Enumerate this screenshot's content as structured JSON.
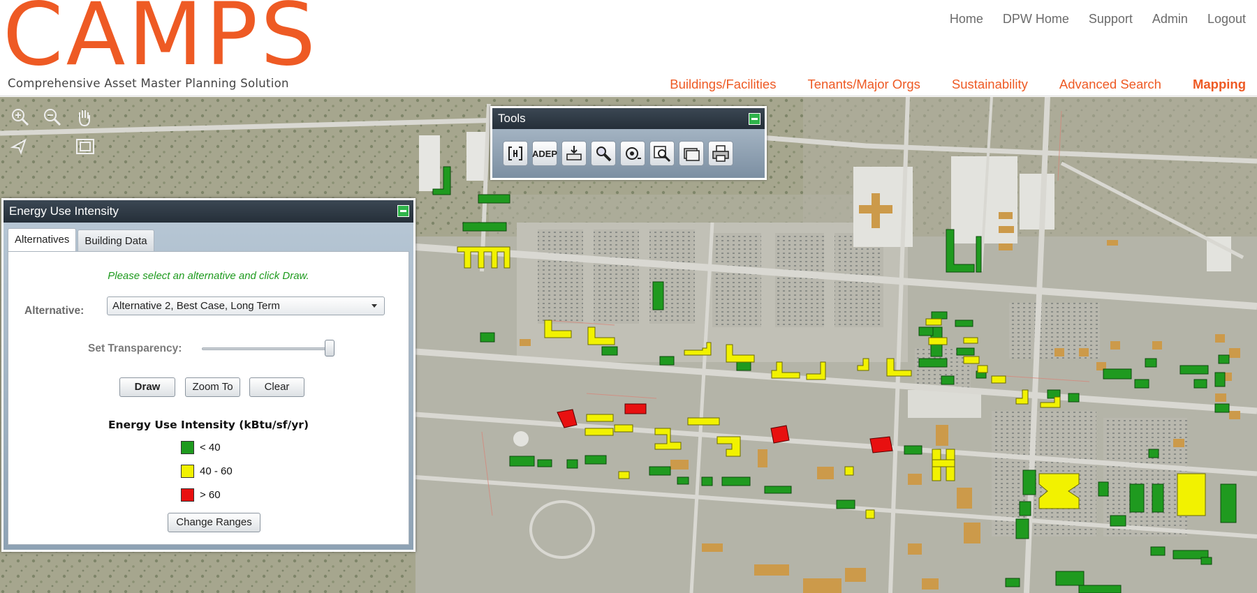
{
  "header": {
    "logo": "CAMPS",
    "logo_subtitle": "Comprehensive Asset Master Planning Solution",
    "top_nav": [
      "Home",
      "DPW Home",
      "Support",
      "Admin",
      "Logout"
    ],
    "main_nav": [
      "Buildings/Facilities",
      "Tenants/Major Orgs",
      "Sustainability",
      "Advanced Search",
      "Mapping"
    ],
    "active_main_nav": "Mapping"
  },
  "map_tools": [
    "zoom-in-icon",
    "zoom-out-icon",
    "pan-hand-icon",
    "select-arrow-icon",
    "full-extent-icon"
  ],
  "tools_panel": {
    "title": "Tools",
    "tools": [
      {
        "name": "compare-tool",
        "label": ""
      },
      {
        "name": "adep-tool",
        "label": "ADEP"
      },
      {
        "name": "import-tool",
        "label": ""
      },
      {
        "name": "search-tool",
        "label": ""
      },
      {
        "name": "measure-tool",
        "label": ""
      },
      {
        "name": "zoom-search-tool",
        "label": ""
      },
      {
        "name": "layers-tool",
        "label": ""
      },
      {
        "name": "print-tool",
        "label": ""
      }
    ]
  },
  "eui_panel": {
    "title": "Energy Use Intensity",
    "tabs": [
      "Alternatives",
      "Building Data"
    ],
    "active_tab": "Alternatives",
    "instruction": "Please select an alternative and click Draw.",
    "alternative_label": "Alternative:",
    "alternative_value": "Alternative 2, Best Case, Long Term",
    "transparency_label": "Set Transparency:",
    "transparency_value": 1.0,
    "buttons": {
      "draw": "Draw",
      "zoom_to": "Zoom To",
      "clear": "Clear"
    },
    "legend_title": "Energy Use Intensity (kBtu/sf/yr)",
    "legend": [
      {
        "label": "< 40",
        "color": "#1f9a1f"
      },
      {
        "label": "40 - 60",
        "color": "#f2f200"
      },
      {
        "label": "> 60",
        "color": "#e81010"
      }
    ],
    "change_ranges": "Change Ranges"
  },
  "colors": {
    "brand": "#ee5a24",
    "eui_low": "#1f9a1f",
    "eui_mid": "#f2f200",
    "eui_high": "#e81010",
    "unclassified": "#cc9a4a"
  }
}
